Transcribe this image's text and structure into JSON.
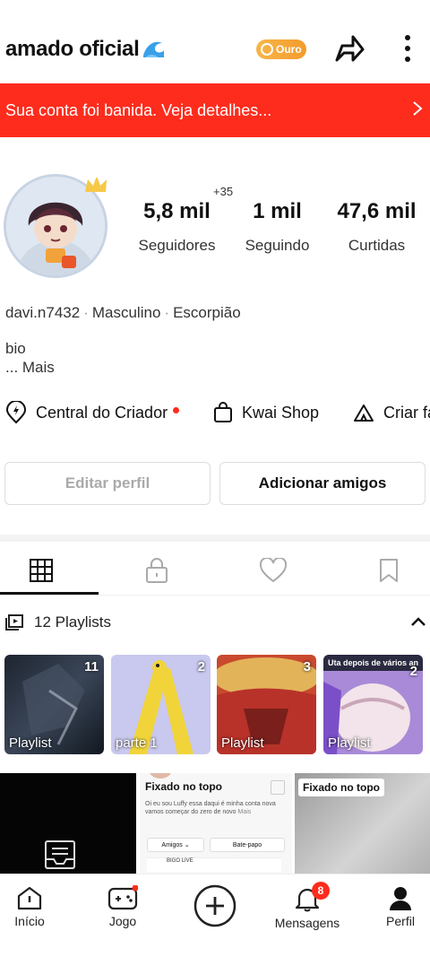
{
  "header": {
    "title": "amado oficial",
    "title_emoji": "🌊",
    "badge": "Ouro"
  },
  "banner": {
    "text": "Sua conta foi banida. Veja detalhes..."
  },
  "stats": {
    "followers_delta": "+35",
    "followers_value": "5,8 mil",
    "followers_label": "Seguidores",
    "following_value": "1 mil",
    "following_label": "Seguindo",
    "likes_value": "47,6 mil",
    "likes_label": "Curtidas"
  },
  "meta": {
    "username": "davi.n7432",
    "gender": "Masculino",
    "sign": "Escorpião"
  },
  "bio": {
    "text": "bio",
    "more": "...  Mais"
  },
  "creator_row": {
    "creator_center": "Central do Criador",
    "shop": "Kwai Shop",
    "create": "Criar fa"
  },
  "buttons": {
    "edit": "Editar perfil",
    "add_friends": "Adicionar amigos"
  },
  "playlists": {
    "header": "12 Playlists",
    "items": [
      {
        "label": "Playlist",
        "count": "11"
      },
      {
        "label": "parte 1",
        "count": "2"
      },
      {
        "label": "Playlist",
        "count": "3"
      },
      {
        "label": "Playlist",
        "count": "2",
        "caption": "Uta depois de vários an"
      }
    ]
  },
  "videos": {
    "pinned_label": "Fixado no topo",
    "pinned_label_2": "Fixado no topo",
    "post_text": "Oi eu sou Luffy essa daqui é minha conta nova vamos começar do zero de novo",
    "post_more": "Mais",
    "friends": "Amigos",
    "chat": "Bate-papo",
    "bigo": "BIGO LIVE"
  },
  "nav": {
    "home": "Início",
    "game": "Jogo",
    "messages": "Mensagens",
    "messages_badge": "8",
    "profile": "Perfil"
  },
  "colors": {
    "banner_red": "#fe2c1d",
    "gold": "#f5a93a"
  }
}
